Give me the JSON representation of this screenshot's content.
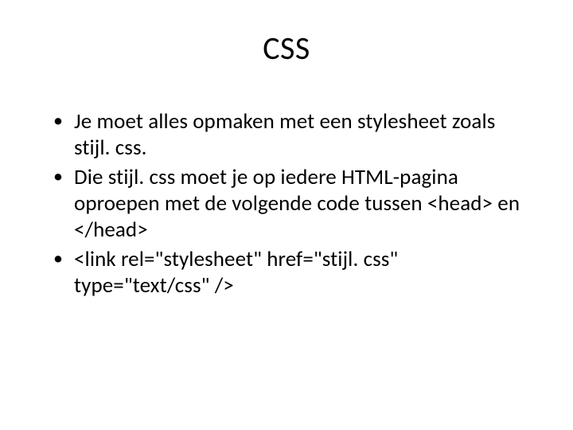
{
  "title": "CSS",
  "bullets": [
    "Je moet alles opmaken met een stylesheet zoals stijl. css.",
    "Die stijl. css moet je op iedere HTML-pagina oproepen met de volgende code tussen <head> en </head>",
    "<link rel=\"stylesheet\" href=\"stijl. css\" type=\"text/css\" />"
  ]
}
